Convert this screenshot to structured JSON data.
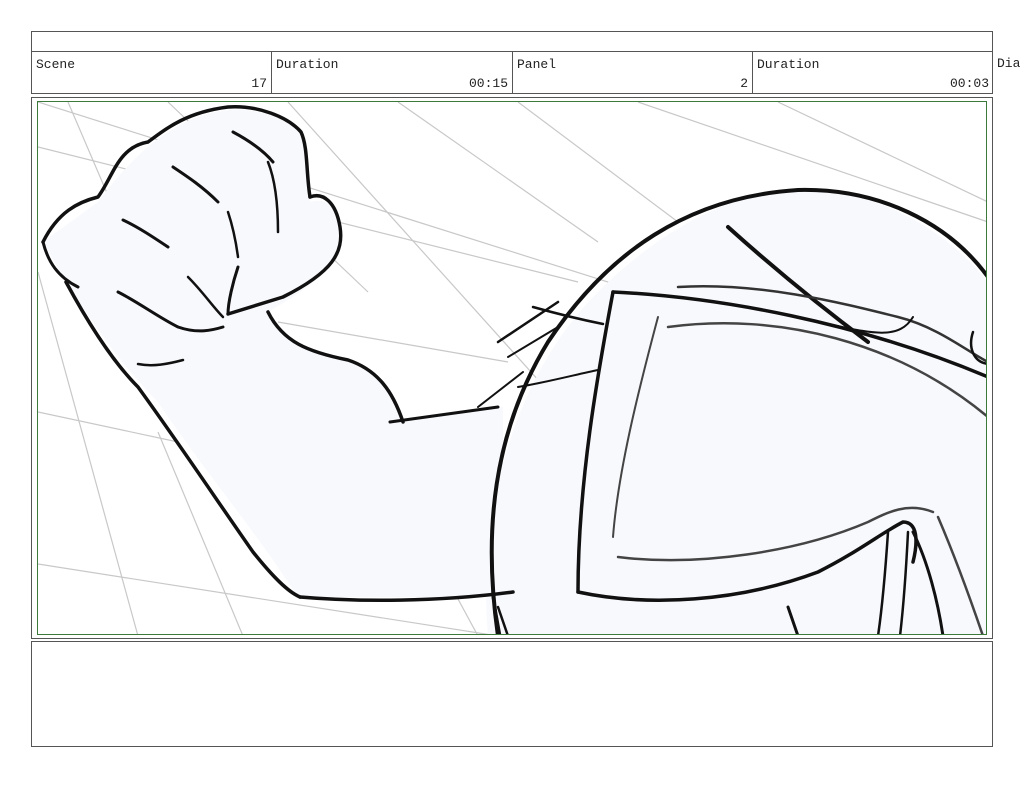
{
  "header": {
    "scene_label": "Scene",
    "scene_value": "17",
    "scene_duration_label": "Duration",
    "scene_duration_value": "00:15",
    "panel_label": "Panel",
    "panel_value": "2",
    "panel_duration_label": "Duration",
    "panel_duration_value": "00:03",
    "dialogue_label": "Dia"
  },
  "panel": {
    "border_color": "#3c7a3c",
    "sketch_fill": "#f8f9fd",
    "ink_color": "#111111",
    "guide_color": "#c8c8c8"
  },
  "notes": {
    "text": ""
  }
}
